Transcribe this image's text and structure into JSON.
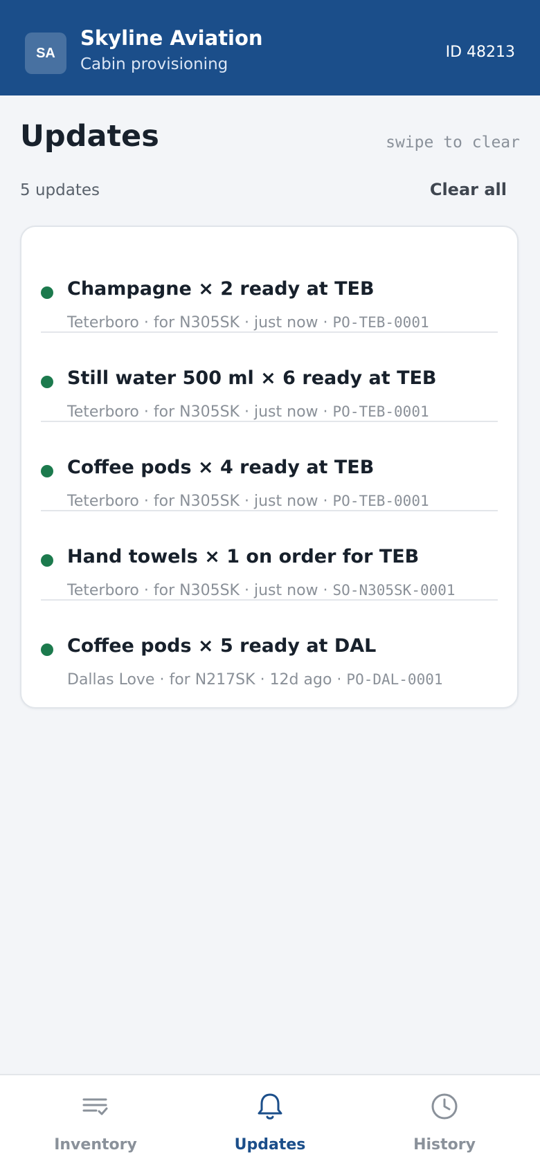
{
  "header": {
    "avatar_initials": "SA",
    "company": "Skyline Aviation",
    "subtitle": "Cabin provisioning",
    "user_id": "ID 48213",
    "background_color": "#1b4e8a"
  },
  "page": {
    "title": "Updates",
    "hint": "swipe to clear",
    "count_label": "5 updates",
    "clear_all_label": "Clear all"
  },
  "updates": [
    {
      "title": "Champagne × 2 ready at TEB",
      "location": "Teterboro",
      "aircraft_text": "for N305SK",
      "time": "just now",
      "reference": "PO-TEB-0001",
      "status_color": "#1c7a4d"
    },
    {
      "title": "Still water 500 ml × 6 ready at TEB",
      "location": "Teterboro",
      "aircraft_text": "for N305SK",
      "time": "just now",
      "reference": "PO-TEB-0001",
      "status_color": "#1c7a4d"
    },
    {
      "title": "Coffee pods × 4 ready at TEB",
      "location": "Teterboro",
      "aircraft_text": "for N305SK",
      "time": "just now",
      "reference": "PO-TEB-0001",
      "status_color": "#1c7a4d"
    },
    {
      "title": "Hand towels × 1 on order for TEB",
      "location": "Teterboro",
      "aircraft_text": "for N305SK",
      "time": "just now",
      "reference": "SO-N305SK-0001",
      "status_color": "#1c7a4d"
    },
    {
      "title": "Coffee pods × 5 ready at DAL",
      "location": "Dallas Love",
      "aircraft_text": "for N217SK",
      "time": "12d ago",
      "reference": "PO-DAL-0001",
      "status_color": "#1c7a4d"
    }
  ],
  "tabs": [
    {
      "label": "Inventory",
      "icon": "checklist-icon",
      "active": false
    },
    {
      "label": "Updates",
      "icon": "bell-icon",
      "active": true
    },
    {
      "label": "History",
      "icon": "clock-icon",
      "active": false
    }
  ],
  "colors": {
    "accent": "#1b4e8a",
    "status_ready": "#1c7a4d",
    "inactive_tab": "#8a919a"
  }
}
